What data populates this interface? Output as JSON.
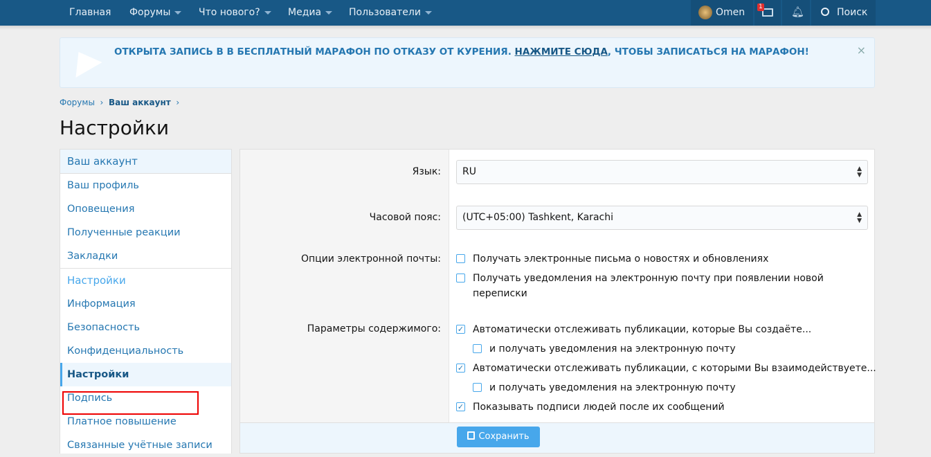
{
  "nav": {
    "items": [
      {
        "label": "Главная",
        "dropdown": false
      },
      {
        "label": "Форумы",
        "dropdown": true
      },
      {
        "label": "Что нового?",
        "dropdown": true
      },
      {
        "label": "Медиа",
        "dropdown": true
      },
      {
        "label": "Пользователи",
        "dropdown": true
      }
    ],
    "user": "Omen",
    "inbox_badge": "1",
    "search": "Поиск"
  },
  "notice": {
    "text": "ОТКРЫТА ЗАПИСЬ В В БЕСПЛАТНЫЙ МАРАФОН ПО ОТКАЗУ ОТ КУРЕНИЯ. ",
    "link": "НАЖМИТЕ СЮДА",
    "text2": ", ЧТОБЫ ЗАПИСАТЬСЯ НА МАРАФОН!",
    "close": "×"
  },
  "breadcrumb": [
    "Форумы",
    "Ваш аккаунт"
  ],
  "title": "Настройки",
  "sidebar": {
    "h1": "Ваш аккаунт",
    "g1": [
      "Ваш профиль",
      "Оповещения",
      "Полученные реакции",
      "Закладки"
    ],
    "h2": "Настройки",
    "g2": [
      "Информация",
      "Безопасность",
      "Конфиденциальность",
      "Настройки",
      "Подпись",
      "Платное повышение",
      "Связанные учётные записи"
    ],
    "selected": "Настройки"
  },
  "form": {
    "language_label": "Язык:",
    "language_value": "RU",
    "tz_label": "Часовой пояс:",
    "tz_value": "(UTC+05:00) Tashkent, Karachi",
    "email_label": "Опции электронной почты:",
    "email_opts": [
      {
        "label": "Получать электронные письма о новостях и обновлениях",
        "checked": false
      },
      {
        "label": "Получать уведомления на электронную почту при появлении новой переписки",
        "checked": false
      }
    ],
    "content_label": "Параметры содержимого:",
    "content_opts": [
      {
        "label": "Автоматически отслеживать публикации, которые Вы создаёте...",
        "checked": true
      },
      {
        "label": "и получать уведомления на электронную почту",
        "checked": false
      },
      {
        "label": "Автоматически отслеживать публикации, с которыми Вы взаимодействуете...",
        "checked": true
      },
      {
        "label": "и получать уведомления на электронную почту",
        "checked": false
      },
      {
        "label": "Показывать подписи людей после их сообщений",
        "checked": true
      }
    ],
    "save": "Сохранить"
  }
}
